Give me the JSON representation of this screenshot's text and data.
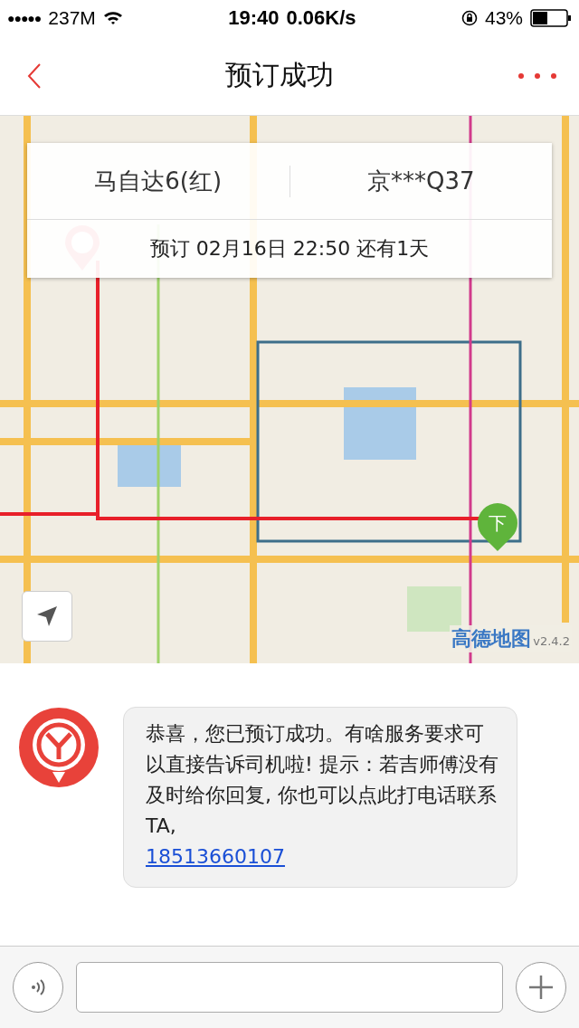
{
  "status_bar": {
    "signal": "●●●●●",
    "carrier": "237M",
    "time": "19:40",
    "speed": "0.06K/s",
    "battery": "43%"
  },
  "nav": {
    "title": "预订成功"
  },
  "map": {
    "car": "马自达6(红)",
    "plate": "京***Q37",
    "booking": "预订 02月16日 22:50 还有1天",
    "dropoff_pin": "下",
    "logo": "高德地图",
    "version": "v2.4.2"
  },
  "messages": [
    {
      "text": "恭喜，您已预订成功。有啥服务要求可以直接告诉司机啦! 提示：若吉师傅没有及时给你回复, 你也可以点此打电话联系TA,",
      "phone": "18513660107"
    }
  ]
}
